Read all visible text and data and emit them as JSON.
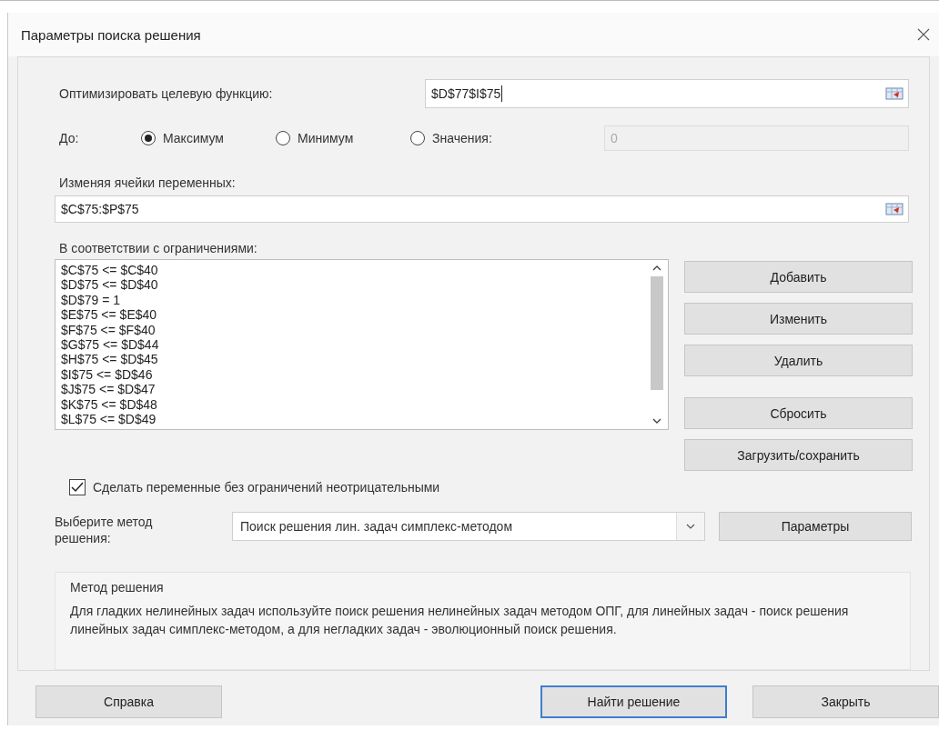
{
  "window": {
    "title": "Параметры поиска решения"
  },
  "objective": {
    "label": "Оптимизировать целевую функцию:",
    "value": "$D$77$I$75"
  },
  "target": {
    "label": "До:",
    "options": [
      {
        "label": "Максимум",
        "selected": true
      },
      {
        "label": "Минимум",
        "selected": false
      },
      {
        "label": "Значения:",
        "selected": false
      }
    ],
    "value_field": {
      "value": "0",
      "disabled": true
    }
  },
  "variables": {
    "label": "Изменяя ячейки переменных:",
    "value": "$C$75:$P$75"
  },
  "constraints": {
    "label": "В соответствии с ограничениями:",
    "items": [
      "$C$75 <= $C$40",
      "$D$75 <= $D$40",
      "$D$79 = 1",
      "$E$75 <= $E$40",
      "$F$75 <= $F$40",
      "$G$75 <= $D$44",
      "$H$75 <= $D$45",
      "$I$75 <= $D$46",
      "$J$75 <= $D$47",
      "$K$75 <= $D$48",
      "$L$75 <= $D$49"
    ]
  },
  "constraint_buttons": [
    "Добавить",
    "Изменить",
    "Удалить",
    "Сбросить",
    "Загрузить/сохранить"
  ],
  "nonnegative": {
    "label": "Сделать переменные без ограничений неотрицательными",
    "checked": true
  },
  "method": {
    "label": "Выберите метод решения:",
    "value": "Поиск решения лин. задач симплекс-методом",
    "options_button": "Параметры"
  },
  "description": {
    "title": "Метод решения",
    "text": "Для гладких нелинейных задач используйте поиск решения нелинейных задач методом ОПГ, для линейных задач - поиск решения линейных задач симплекс-методом, а для негладких задач - эволюционный поиск решения."
  },
  "footer_buttons": [
    {
      "label": "Справка",
      "default": false
    },
    {
      "label": "Найти решение",
      "default": true
    },
    {
      "label": "Закрыть",
      "default": false
    }
  ]
}
